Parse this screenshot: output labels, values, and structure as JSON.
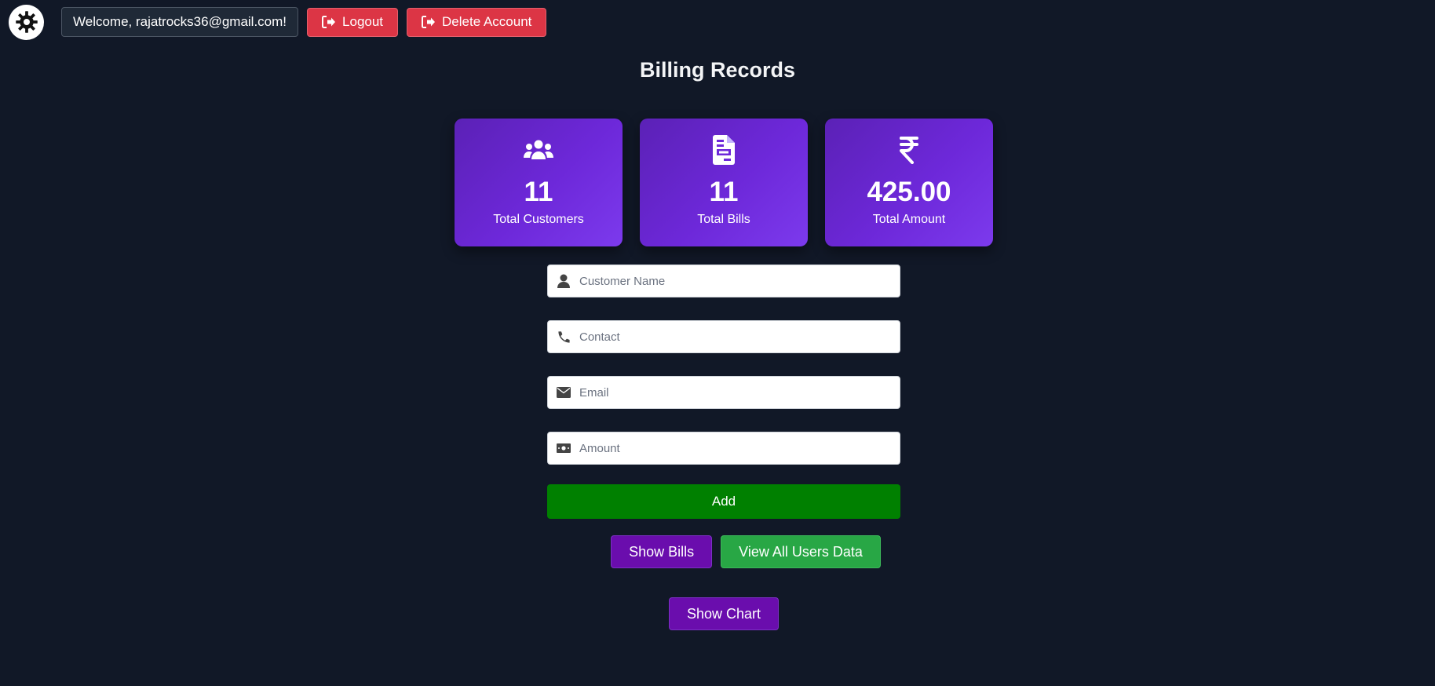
{
  "header": {
    "welcome_text": "Welcome, rajatrocks36@gmail.com!",
    "logout_label": "Logout",
    "delete_label": "Delete Account"
  },
  "page": {
    "title": "Billing Records"
  },
  "stats": [
    {
      "value": "11",
      "label": "Total Customers",
      "icon": "users-icon"
    },
    {
      "value": "11",
      "label": "Total Bills",
      "icon": "file-invoice-icon"
    },
    {
      "value": "425.00",
      "label": "Total Amount",
      "icon": "rupee-icon"
    }
  ],
  "form": {
    "name_placeholder": "Customer Name",
    "contact_placeholder": "Contact",
    "email_placeholder": "Email",
    "amount_placeholder": "Amount",
    "add_label": "Add"
  },
  "actions": {
    "show_bills_label": "Show Bills",
    "view_all_label": "View All Users Data",
    "show_chart_label": "Show Chart"
  },
  "colors": {
    "background": "#111827",
    "card_gradient_start": "#5b21b6",
    "card_gradient_end": "#7c3aed",
    "danger": "#dc3545",
    "add_green": "#008000",
    "success": "#28a745",
    "purple_button": "#6a0dad"
  }
}
